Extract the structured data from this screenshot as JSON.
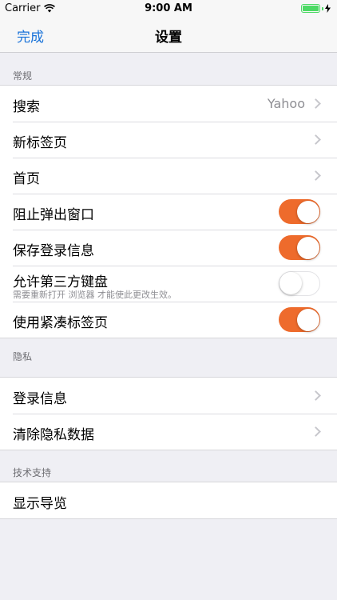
{
  "status_bar": {
    "carrier": "Carrier",
    "time": "9:00 AM",
    "battery_level": 1.0
  },
  "nav": {
    "done_label": "完成",
    "title": "设置"
  },
  "colors": {
    "accent": "#1a73d9",
    "switch_on": "#ee6b2c",
    "background": "#efeff4"
  },
  "sections": {
    "general": {
      "header": "常规",
      "search_label": "搜索",
      "search_value": "Yahoo",
      "new_tab_label": "新标签页",
      "home_label": "首页",
      "block_popups_label": "阻止弹出窗口",
      "block_popups_on": true,
      "save_logins_label": "保存登录信息",
      "save_logins_on": true,
      "third_party_kb_label": "允许第三方键盘",
      "third_party_kb_sub": "需要重新打开 浏览器 才能使此更改生效。",
      "third_party_kb_on": false,
      "compact_tabs_label": "使用紧凑标签页",
      "compact_tabs_on": true
    },
    "privacy": {
      "header": "隐私",
      "logins_label": "登录信息",
      "clear_data_label": "清除隐私数据"
    },
    "support": {
      "header": "技术支持",
      "show_tour_label": "显示导览"
    }
  },
  "icons": {
    "wifi": "wifi-icon",
    "battery": "battery-icon",
    "chevron": "chevron-right-icon",
    "charging": "charging-bolt-icon"
  }
}
